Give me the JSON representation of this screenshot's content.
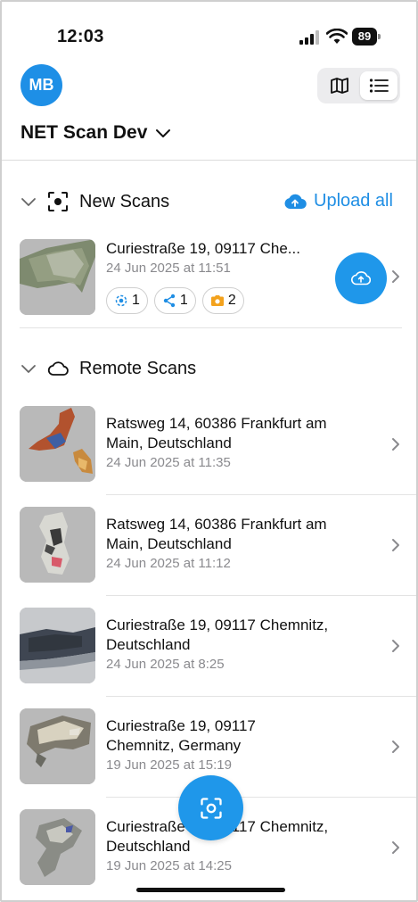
{
  "status_bar": {
    "time": "12:03",
    "battery": "89"
  },
  "header": {
    "avatar_initials": "MB",
    "project_name": "NET Scan Dev",
    "view_toggle": {
      "map_icon": "map-icon",
      "list_icon": "list-icon",
      "selected": "list"
    }
  },
  "new_scans": {
    "title": "New Scans",
    "upload_all_label": "Upload all",
    "items": [
      {
        "title": "Curiestraße 19, 09117 Che...",
        "date": "24 Jun 2025 at 11:51",
        "chips": [
          {
            "icon": "scan-target-icon",
            "count": "1"
          },
          {
            "icon": "share-nodes-icon",
            "count": "1"
          },
          {
            "icon": "camera-icon",
            "count": "2"
          }
        ]
      }
    ]
  },
  "remote_scans": {
    "title": "Remote Scans",
    "items": [
      {
        "title_line1": "Ratsweg 14, 60386 Frankfurt am",
        "title_line2": "Main, Deutschland",
        "date": "24 Jun 2025 at 11:35"
      },
      {
        "title_line1": "Ratsweg 14, 60386 Frankfurt am",
        "title_line2": "Main, Deutschland",
        "date": "24 Jun 2025 at 11:12"
      },
      {
        "title_line1": "Curiestraße 19, 09117 Chemnitz,",
        "title_line2": "Deutschland",
        "date": "24 Jun 2025 at 8:25"
      },
      {
        "title_line1": "Curiestraße 19, 09117",
        "title_line2": "Chemnitz, Germany",
        "date": "19 Jun 2025 at 15:19"
      },
      {
        "title_line1": "Curiestraße 19, 09117 Chemnitz,",
        "title_line2": "Deutschland",
        "date": "19 Jun 2025 at 14:25"
      }
    ]
  },
  "colors": {
    "accent": "#1f97ea",
    "chip_camera": "#f3a21d",
    "avatar": "#1e8fe6"
  }
}
